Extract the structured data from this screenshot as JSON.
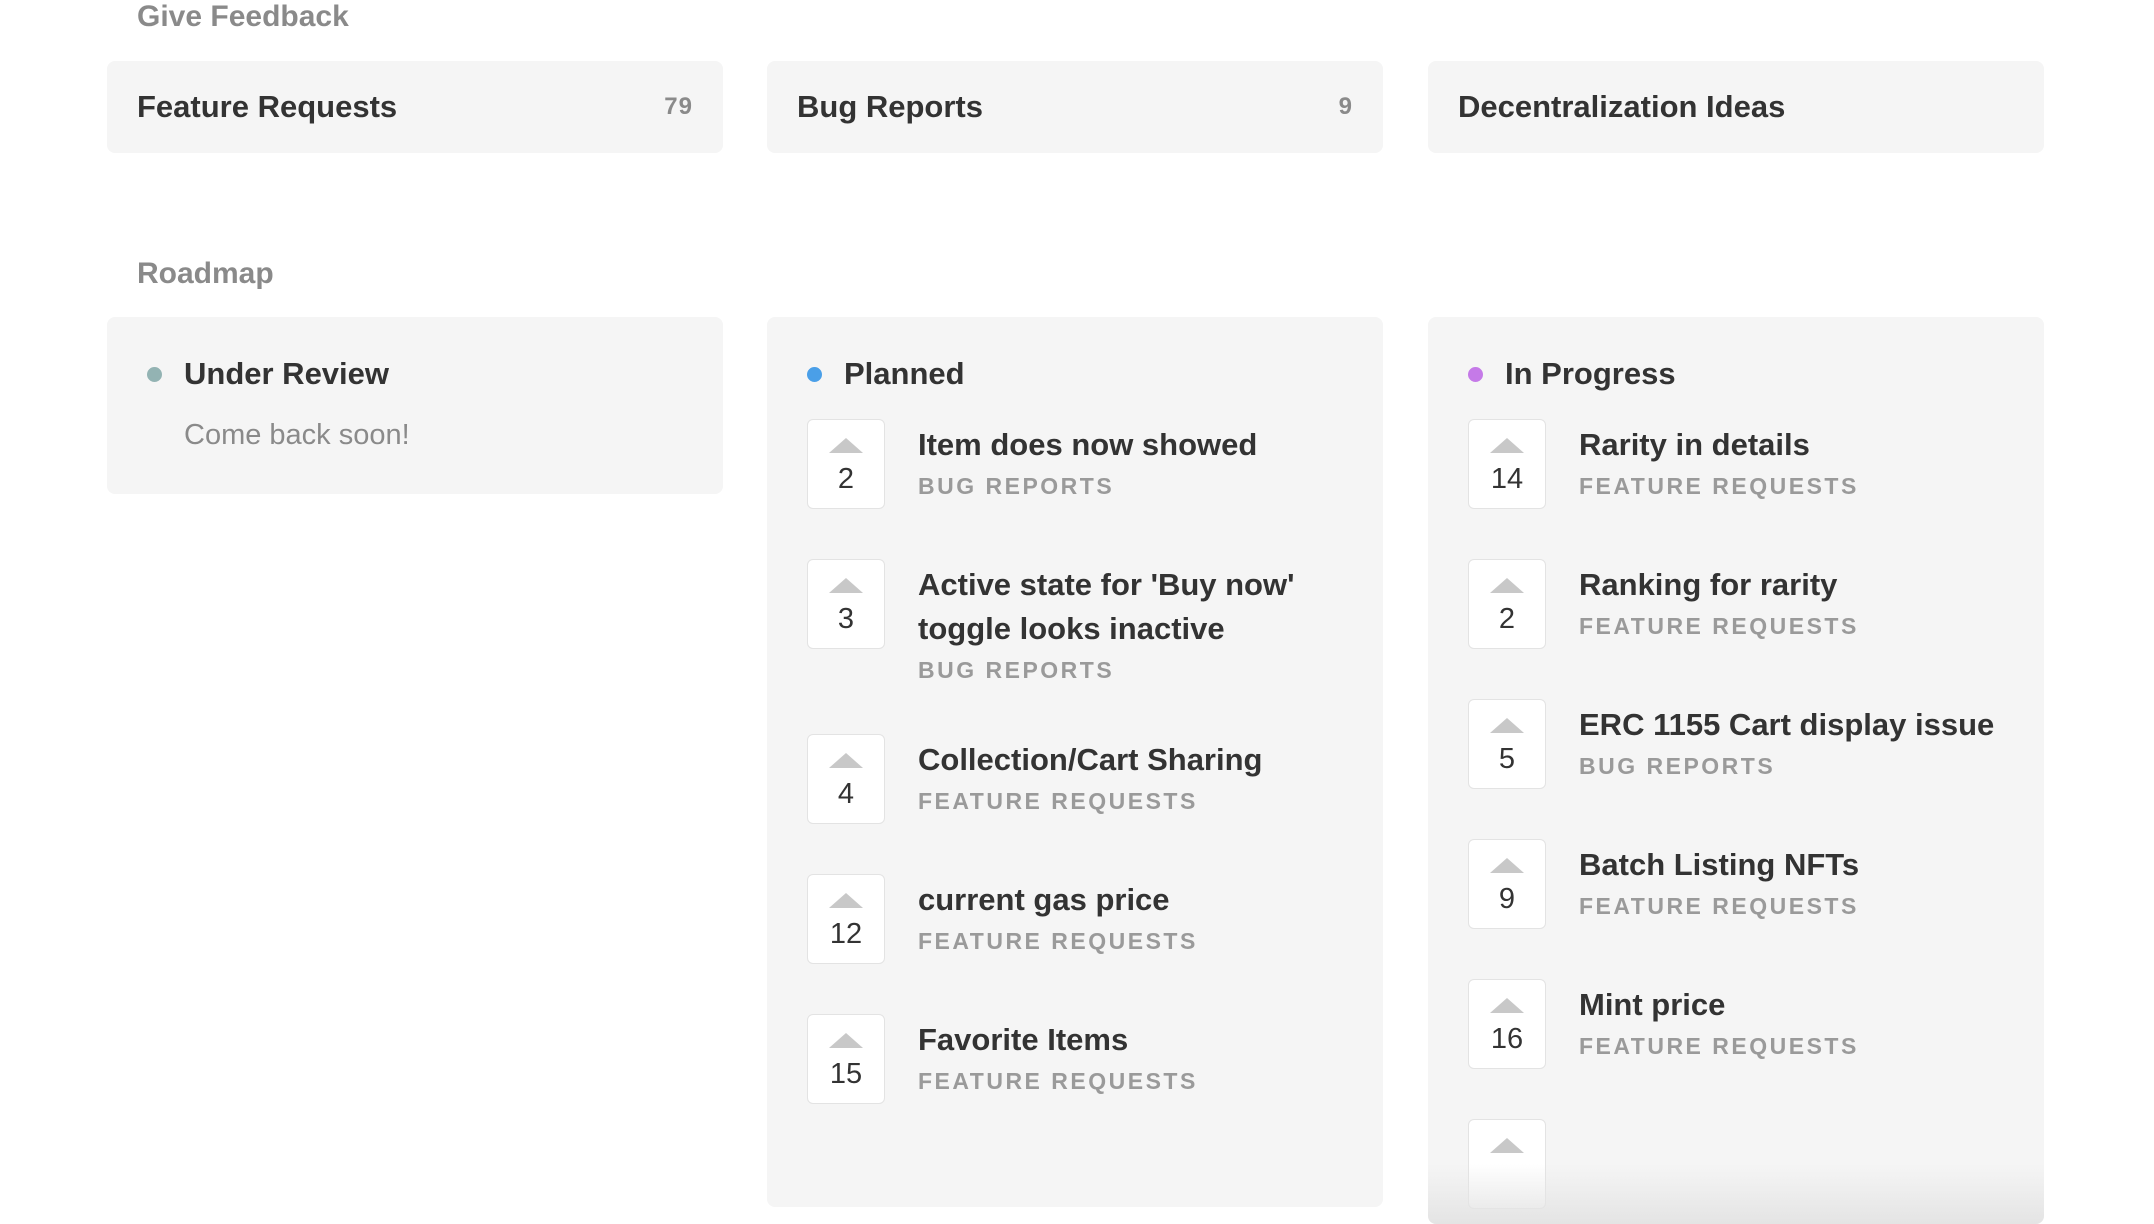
{
  "feedback": {
    "title": "Give Feedback",
    "boards": [
      {
        "name": "Feature Requests",
        "count": "79"
      },
      {
        "name": "Bug Reports",
        "count": "9"
      },
      {
        "name": "Decentralization Ideas",
        "count": ""
      }
    ]
  },
  "roadmap": {
    "title": "Roadmap",
    "columns": [
      {
        "title": "Under Review",
        "color": "#93b3b3",
        "empty": "Come back soon!",
        "posts": []
      },
      {
        "title": "Planned",
        "color": "#4a9fe8",
        "empty": "",
        "posts": [
          {
            "votes": "2",
            "title": "Item does now showed",
            "category": "Bug Reports"
          },
          {
            "votes": "3",
            "title": "Active state for 'Buy now' toggle looks inactive",
            "category": "Bug Reports"
          },
          {
            "votes": "4",
            "title": "Collection/Cart Sharing",
            "category": "Feature Requests"
          },
          {
            "votes": "12",
            "title": "current gas price",
            "category": "Feature Requests"
          },
          {
            "votes": "15",
            "title": "Favorite Items",
            "category": "Feature Requests"
          }
        ]
      },
      {
        "title": "In Progress",
        "color": "#c57ae8",
        "empty": "",
        "posts": [
          {
            "votes": "14",
            "title": "Rarity in details",
            "category": "Feature Requests"
          },
          {
            "votes": "2",
            "title": "Ranking for rarity",
            "category": "Feature Requests"
          },
          {
            "votes": "5",
            "title": "ERC 1155 Cart display issue",
            "category": "Bug Reports"
          },
          {
            "votes": "9",
            "title": "Batch Listing NFTs",
            "category": "Feature Requests"
          },
          {
            "votes": "16",
            "title": "Mint price",
            "category": "Feature Requests"
          }
        ]
      }
    ]
  }
}
